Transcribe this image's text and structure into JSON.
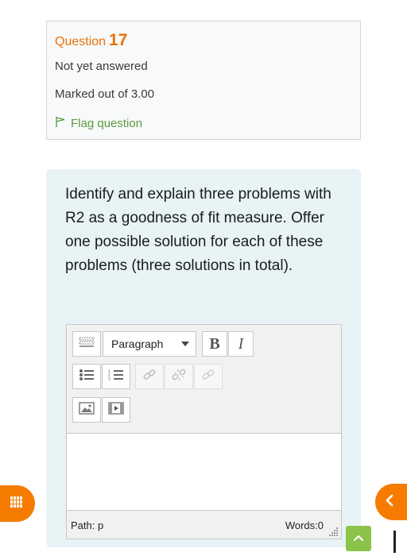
{
  "question_info": {
    "label": "Question",
    "number": "17",
    "status": "Not yet answered",
    "marks": "Marked out of 3.00",
    "flag_label": "Flag question"
  },
  "question": {
    "text": "Identify and explain three problems with R2 as a goodness of fit measure. Offer one possible solution for each of these problems (three solutions in total)."
  },
  "editor": {
    "paragraph_label": "Paragraph",
    "bold_label": "B",
    "italic_label": "I",
    "path_label": "Path: p",
    "words_label": "Words:0"
  },
  "colors": {
    "accent_orange": "#f57c00",
    "question_label": "#e8710a",
    "flag_green": "#5a9a3f",
    "content_bg": "#e7f3f5",
    "up_button": "#8bc34a"
  }
}
